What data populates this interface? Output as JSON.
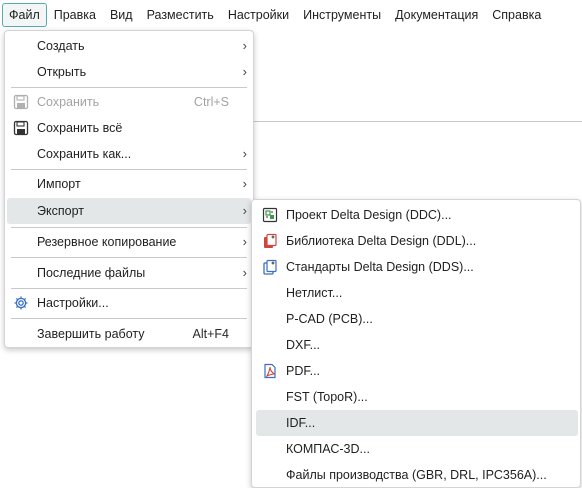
{
  "menubar": {
    "items": [
      "Файл",
      "Правка",
      "Вид",
      "Разместить",
      "Настройки",
      "Инструменты",
      "Документация",
      "Справка"
    ]
  },
  "file_menu": {
    "create": "Создать",
    "open": "Открыть",
    "save": "Сохранить",
    "save_shortcut": "Ctrl+S",
    "save_all": "Сохранить всё",
    "save_as": "Сохранить как...",
    "import": "Импорт",
    "export": "Экспорт",
    "backup": "Резервное копирование",
    "recent": "Последние файлы",
    "settings": "Настройки...",
    "exit": "Завершить работу",
    "exit_shortcut": "Alt+F4",
    "submenu_arrow": "›"
  },
  "export_menu": {
    "items": [
      "Проект Delta Design (DDC)...",
      "Библиотека Delta Design (DDL)...",
      "Стандарты Delta Design (DDS)...",
      "Нетлист...",
      "P-CAD (PCB)...",
      "DXF...",
      "PDF...",
      "FST (TopoR)...",
      "IDF...",
      "КОМПАС-3D...",
      "Файлы производства (GBR, DRL, IPC356A)..."
    ]
  },
  "colors": {
    "accent_border": "#5aa9ad",
    "hover_bg": "#e4e7e7",
    "icon_red": "#d0453d",
    "icon_green": "#3a9a4a",
    "icon_blue": "#3a6fc4"
  }
}
